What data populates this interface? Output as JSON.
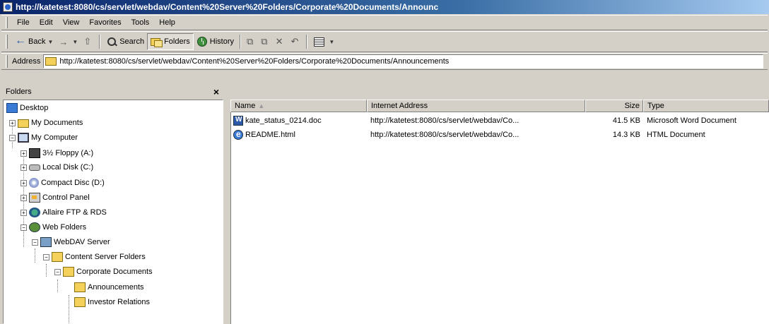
{
  "window": {
    "title": "http://katetest:8080/cs/servlet/webdav/Content%20Server%20Folders/Corporate%20Documents/Announc"
  },
  "menu": {
    "items": [
      "File",
      "Edit",
      "View",
      "Favorites",
      "Tools",
      "Help"
    ]
  },
  "toolbar": {
    "back_label": "Back",
    "search_label": "Search",
    "folders_label": "Folders",
    "history_label": "History"
  },
  "address": {
    "label": "Address",
    "value": "http://katetest:8080/cs/servlet/webdav/Content%20Server%20Folders/Corporate%20Documents/Announcements"
  },
  "folders_pane": {
    "title": "Folders",
    "close_glyph": "×",
    "tree": [
      {
        "label": "Desktop",
        "icon": "desktop-icon"
      },
      {
        "label": "My Documents",
        "icon": "folder-icon"
      },
      {
        "label": "My Computer",
        "icon": "computer-icon"
      },
      {
        "label": "3½ Floppy (A:)",
        "icon": "floppy-icon"
      },
      {
        "label": "Local Disk (C:)",
        "icon": "disk-icon"
      },
      {
        "label": "Compact Disc (D:)",
        "icon": "cd-icon"
      },
      {
        "label": "Control Panel",
        "icon": "control-panel-icon"
      },
      {
        "label": "Allaire FTP & RDS",
        "icon": "ftp-icon"
      },
      {
        "label": "Web Folders",
        "icon": "web-folders-icon"
      },
      {
        "label": "WebDAV Server",
        "icon": "server-icon"
      },
      {
        "label": "Content Server Folders",
        "icon": "folder-icon"
      },
      {
        "label": "Corporate Documents",
        "icon": "folder-icon"
      },
      {
        "label": "Announcements",
        "icon": "folder-icon"
      },
      {
        "label": "Investor Relations",
        "icon": "folder-icon"
      }
    ]
  },
  "list": {
    "columns": [
      "Name",
      "Internet Address",
      "Size",
      "Type"
    ],
    "sort_indicator": "▲",
    "rows": [
      {
        "name": "kate_status_0214.doc",
        "address": "http://katetest:8080/cs/servlet/webdav/Co...",
        "size": "41.5 KB",
        "type": "Microsoft Word Document",
        "icon": "word-doc-icon"
      },
      {
        "name": "README.html",
        "address": "http://katetest:8080/cs/servlet/webdav/Co...",
        "size": "14.3 KB",
        "type": "HTML Document",
        "icon": "html-doc-icon"
      }
    ]
  }
}
